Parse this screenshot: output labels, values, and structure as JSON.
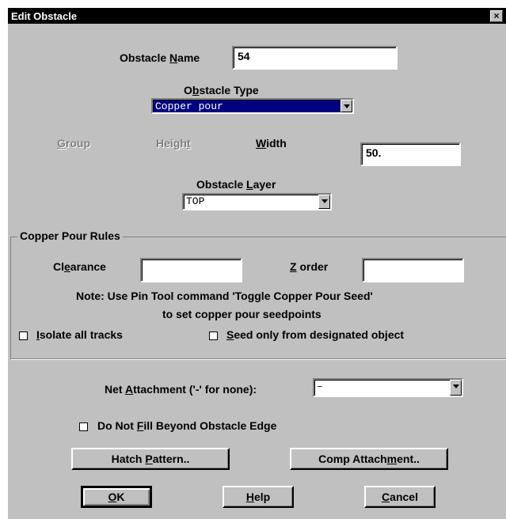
{
  "window": {
    "title": "Edit Obstacle",
    "close_glyph": "×"
  },
  "obstacle_name": {
    "label_pre": "Obstacle ",
    "label_key": "N",
    "label_post": "ame",
    "value": "54"
  },
  "obstacle_type": {
    "label_pre": "O",
    "label_key": "b",
    "label_post": "stacle Type",
    "value": "Copper pour"
  },
  "group": {
    "label_key": "G",
    "label_post": "roup"
  },
  "height": {
    "label_pre": "Heigh",
    "label_key": "t"
  },
  "width": {
    "label_key": "W",
    "label_post": "idth",
    "value": "50."
  },
  "obstacle_layer": {
    "label_pre": "Obstacle ",
    "label_key": "L",
    "label_post": "ayer",
    "value": "TOP"
  },
  "copper_rules": {
    "title": "Copper Pour Rules",
    "clearance": {
      "label_pre": "Cl",
      "label_key": "e",
      "label_post": "arance",
      "value": ""
    },
    "zorder": {
      "label_key": "Z",
      "label_post": " order",
      "value": ""
    },
    "note_line1": "Note: Use Pin Tool command 'Toggle Copper Pour Seed'",
    "note_line2": "to set copper pour seedpoints",
    "isolate": {
      "label_key": "I",
      "label_post": "solate all tracks",
      "checked": false
    },
    "seed": {
      "label_key": "S",
      "label_post": "eed only from designated object",
      "checked": false
    }
  },
  "net_attachment": {
    "label_pre": "Net ",
    "label_key": "A",
    "label_post": "ttachment ('-' for none):",
    "value": "–"
  },
  "do_not_fill": {
    "label_pre": "Do Not ",
    "label_key": "F",
    "label_post": "ill Beyond Obstacle Edge",
    "checked": false
  },
  "buttons": {
    "hatch": {
      "label_pre": "Hatch ",
      "label_key": "P",
      "label_post": "attern.."
    },
    "comp": {
      "label_pre": "Comp Attach",
      "label_key": "m",
      "label_post": "ent.."
    },
    "ok": {
      "label_key": "O",
      "label_post": "K"
    },
    "help": {
      "label_key": "H",
      "label_post": "elp"
    },
    "cancel": {
      "label_key": "C",
      "label_post": "ancel"
    }
  }
}
